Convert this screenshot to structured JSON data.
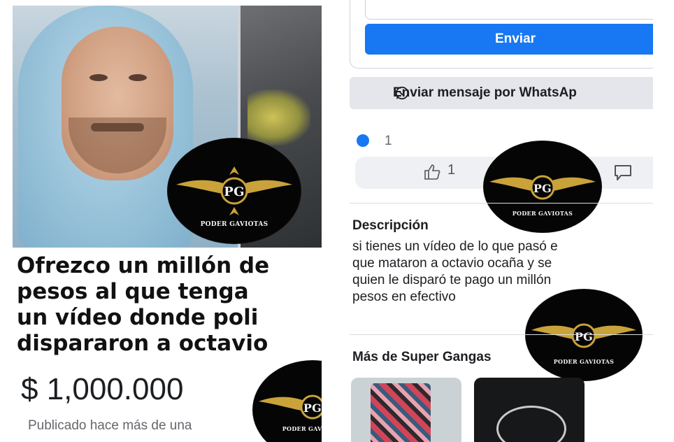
{
  "left_post": {
    "title_lines": [
      "Ofrezco un millón de",
      "pesos al que tenga",
      "un vídeo donde poli",
      "dispararon a octavio"
    ],
    "price": "$ 1,000.000",
    "published": "Publicado hace más de una"
  },
  "right_post": {
    "send_button": "Enviar",
    "whatsapp_button": "Enviar mensaje por WhatsAp",
    "reaction_count": "1",
    "like_count": "1",
    "description_title": "Descripción",
    "description_lines": [
      "si tienes un vídeo de lo que pasó e",
      "que mataron a octavio ocaña y se",
      "quien le disparó te pago un millón",
      "pesos en efectivo"
    ],
    "more_from": "Más de Super Gangas"
  },
  "watermark": {
    "initials": "PG",
    "name": "PODER GAVIOTAS"
  },
  "colors": {
    "facebook_blue": "#1877f2",
    "button_gray": "#e4e6eb",
    "logo_gold": "#c9a23a",
    "logo_black": "#050505"
  },
  "icons": [
    "whatsapp-icon",
    "like-badge-icon",
    "thumbs-up-icon",
    "comment-icon"
  ]
}
